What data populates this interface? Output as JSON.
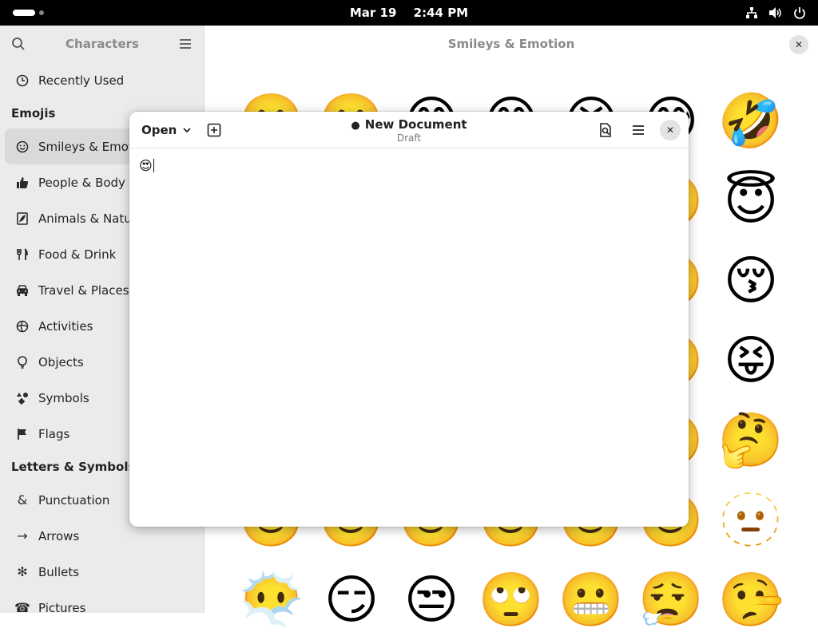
{
  "topbar": {
    "date": "Mar 19",
    "time": "2:44 PM"
  },
  "sidebar": {
    "title": "Characters",
    "items_top": [
      {
        "label": "Recently Used",
        "icon": "clock-icon"
      }
    ],
    "section_emojis": "Emojis",
    "emoji_items": [
      {
        "label": "Smileys & Emotion",
        "icon": "smiley-icon",
        "selected": true
      },
      {
        "label": "People & Body",
        "icon": "thumbs-up-icon"
      },
      {
        "label": "Animals & Nature",
        "icon": "leaf-icon"
      },
      {
        "label": "Food & Drink",
        "icon": "fork-knife-icon"
      },
      {
        "label": "Travel & Places",
        "icon": "car-icon"
      },
      {
        "label": "Activities",
        "icon": "ball-icon"
      },
      {
        "label": "Objects",
        "icon": "lightbulb-icon"
      },
      {
        "label": "Symbols",
        "icon": "shapes-icon"
      },
      {
        "label": "Flags",
        "icon": "flag-icon"
      }
    ],
    "section_letters": "Letters & Symbols",
    "letter_items": [
      {
        "label": "Punctuation",
        "glyph": "&"
      },
      {
        "label": "Arrows",
        "glyph": "→"
      },
      {
        "label": "Bullets",
        "glyph": "✻"
      },
      {
        "label": "Pictures",
        "glyph": "☎"
      }
    ]
  },
  "main": {
    "title": "Smileys & Emotion",
    "emojis": [
      "🙂",
      "🙂",
      "😊",
      "😊",
      "😆",
      "😅",
      "🤣",
      "🙂",
      "🙂",
      "🙂",
      "🙂",
      "🙂",
      "🙂",
      "😇",
      "🙂",
      "🙂",
      "🙂",
      "🙂",
      "🙂",
      "🙂",
      "😚",
      "🙂",
      "🙂",
      "🙂",
      "🙂",
      "🙂",
      "🙂",
      "😝",
      "🙂",
      "🙂",
      "🙂",
      "🙂",
      "🙂",
      "🙂",
      "🤔",
      "🙂",
      "🙂",
      "🙂",
      "🙂",
      "🙂",
      "🙂",
      "🫥",
      "😶‍🌫️",
      "😏",
      "😒",
      "🙄",
      "😬",
      "😮‍💨",
      "🤥"
    ]
  },
  "editor": {
    "open_label": "Open",
    "doc_title": "New Document",
    "doc_subtitle": "Draft",
    "content": "😍"
  }
}
